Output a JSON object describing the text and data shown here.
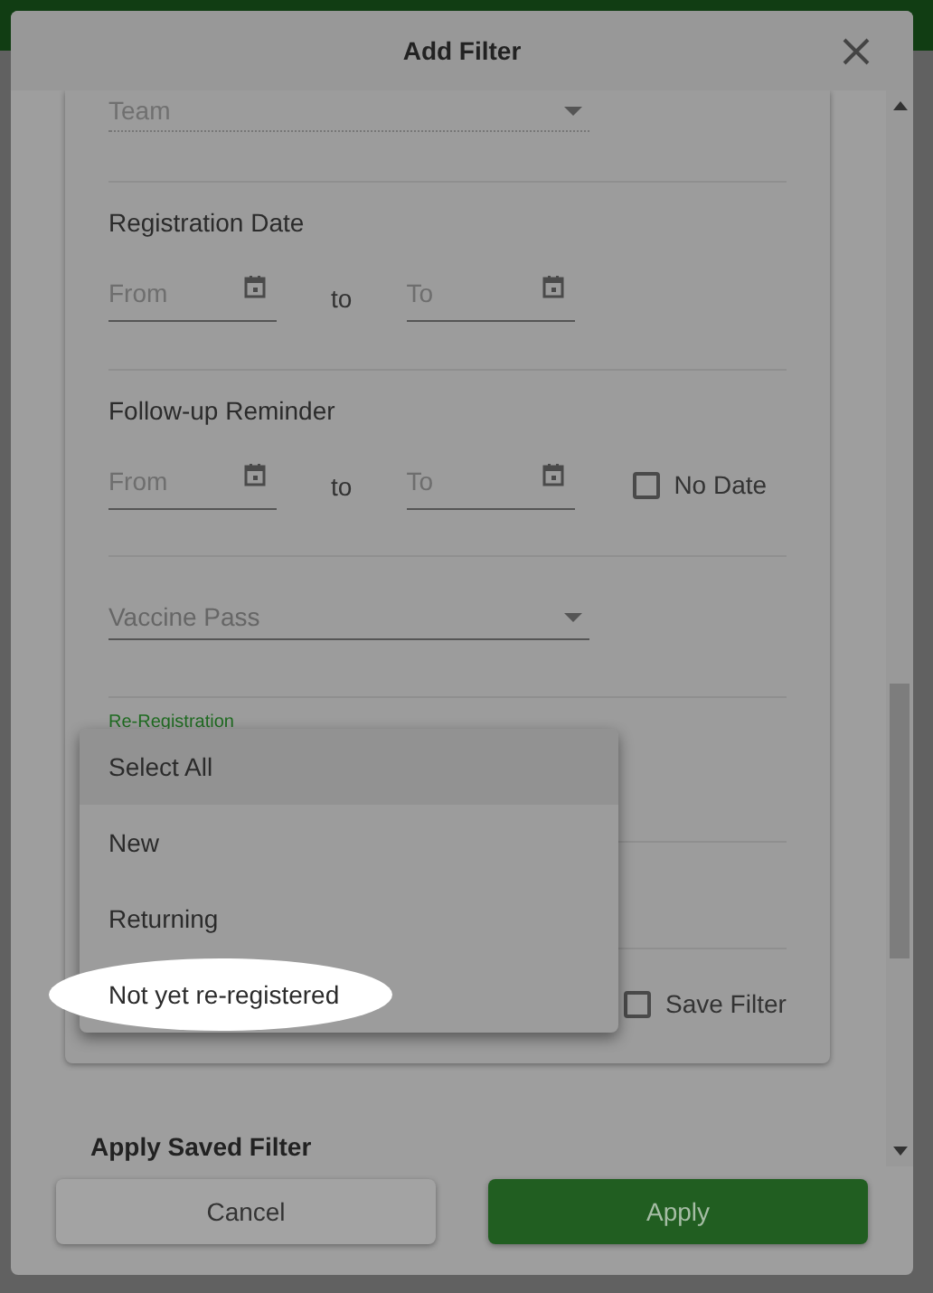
{
  "dialog": {
    "title": "Add Filter"
  },
  "sections": [
    {
      "kind": "select",
      "placeholder": "Team",
      "disabled": true
    },
    {
      "kind": "date_range",
      "label": "Registration Date",
      "from": "From",
      "separator": "to",
      "to": "To"
    },
    {
      "kind": "date_range",
      "label": "Follow-up Reminder",
      "from": "From",
      "separator": "to",
      "to": "To",
      "checkbox": {
        "label": "No Date",
        "checked": false
      }
    },
    {
      "kind": "select",
      "placeholder": "Vaccine Pass",
      "disabled": false
    },
    {
      "kind": "focused_label",
      "label": "Re-Registration"
    },
    {
      "kind": "blank"
    },
    {
      "kind": "checkbox",
      "label": "Save Filter",
      "checked": false
    }
  ],
  "menu": [
    {
      "label": "Select All",
      "selected": true,
      "annotated": false
    },
    {
      "label": "New",
      "selected": false,
      "annotated": false
    },
    {
      "label": "Returning",
      "selected": false,
      "annotated": false
    },
    {
      "label": "Not yet re-registered",
      "selected": false,
      "annotated": true
    }
  ],
  "saved_filter_heading": "Apply Saved Filter",
  "buttons": [
    {
      "label": "Cancel",
      "kind": "secondary"
    },
    {
      "label": "Apply",
      "kind": "primary"
    }
  ]
}
